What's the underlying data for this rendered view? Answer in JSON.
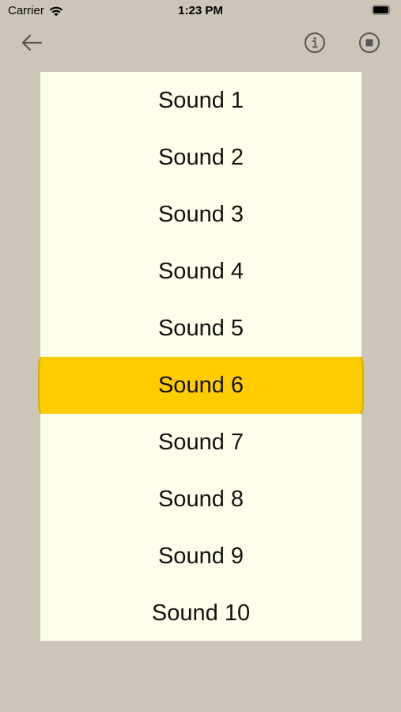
{
  "status_bar": {
    "carrier": "Carrier",
    "time": "1:23 PM",
    "wifi_icon": "wifi-icon",
    "battery_icon": "battery-icon"
  },
  "nav": {
    "back_icon": "arrow-left-icon",
    "info_icon": "info-circle-icon",
    "stop_icon": "stop-circle-icon"
  },
  "sounds": {
    "items": [
      {
        "label": "Sound 1",
        "selected": false
      },
      {
        "label": "Sound 2",
        "selected": false
      },
      {
        "label": "Sound 3",
        "selected": false
      },
      {
        "label": "Sound 4",
        "selected": false
      },
      {
        "label": "Sound 5",
        "selected": false
      },
      {
        "label": "Sound 6",
        "selected": true
      },
      {
        "label": "Sound 7",
        "selected": false
      },
      {
        "label": "Sound 8",
        "selected": false
      },
      {
        "label": "Sound 9",
        "selected": false
      },
      {
        "label": "Sound 10",
        "selected": false
      }
    ]
  },
  "colors": {
    "background": "#cdc6b8",
    "list_background": "#fffeea",
    "selected_row": "#ffcc00",
    "icon_color": "#555555"
  }
}
